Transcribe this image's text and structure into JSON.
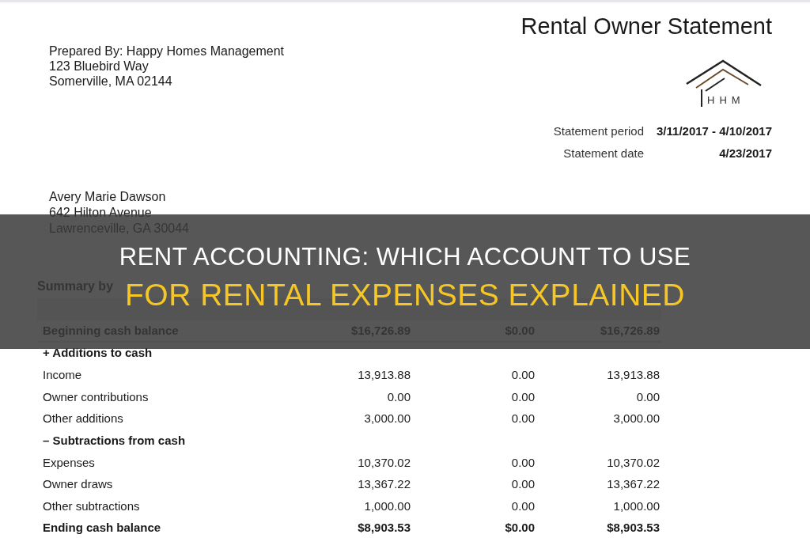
{
  "statement": {
    "title": "Rental Owner Statement",
    "prepared_by": [
      "Prepared By: Happy Homes Management",
      "123 Bluebird Way",
      "Somerville, MA 02144"
    ],
    "logo_text": "HHM",
    "details": [
      {
        "label": "Statement period",
        "value": "3/11/2017 - 4/10/2017"
      },
      {
        "label": "Statement date",
        "value": "4/23/2017"
      }
    ],
    "recipient": [
      "Avery Marie Dawson",
      "642 Hilton Avenue",
      "Lawrenceville, GA 30044"
    ]
  },
  "summary": {
    "heading": "Summary by",
    "rows": [
      {
        "kind": "total",
        "label": "Beginning cash balance",
        "values": [
          "$16,726.89",
          "$0.00",
          "$16,726.89"
        ]
      },
      {
        "kind": "section",
        "label": "+ Additions to cash"
      },
      {
        "kind": "item",
        "label": "Income",
        "values": [
          "13,913.88",
          "0.00",
          "13,913.88"
        ]
      },
      {
        "kind": "item",
        "label": "Owner contributions",
        "values": [
          "0.00",
          "0.00",
          "0.00"
        ]
      },
      {
        "kind": "item",
        "label": "Other additions",
        "values": [
          "3,000.00",
          "0.00",
          "3,000.00"
        ]
      },
      {
        "kind": "section",
        "label": "– Subtractions from cash"
      },
      {
        "kind": "item",
        "label": "Expenses",
        "values": [
          "10,370.02",
          "0.00",
          "10,370.02"
        ]
      },
      {
        "kind": "item",
        "label": "Owner draws",
        "values": [
          "13,367.22",
          "0.00",
          "13,367.22"
        ]
      },
      {
        "kind": "item",
        "label": "Other subtractions",
        "values": [
          "1,000.00",
          "0.00",
          "1,000.00"
        ]
      },
      {
        "kind": "total",
        "label": "Ending cash balance",
        "values": [
          "$8,903.53",
          "$0.00",
          "$8,903.53"
        ]
      }
    ]
  },
  "banner": {
    "lines": [
      "RENT ACCOUNTING: WHICH ACCOUNT TO USE",
      "FOR RENTAL EXPENSES EXPLAINED"
    ]
  }
}
